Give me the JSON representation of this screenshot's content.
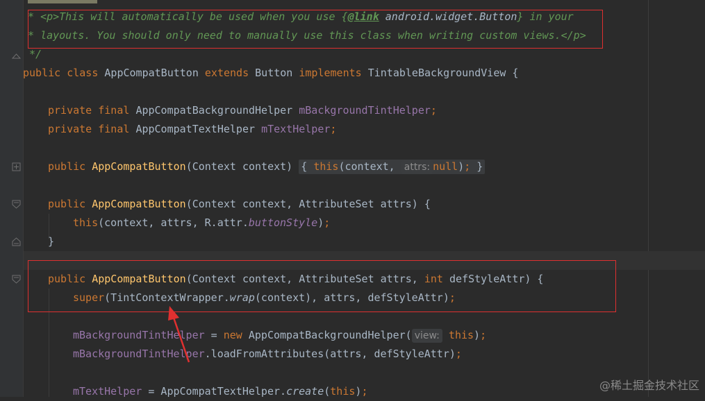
{
  "colors": {
    "background": "#2b2b2b",
    "keyword": "#cc7832",
    "method": "#ffc66d",
    "field": "#9876aa",
    "comment": "#629755",
    "text": "#a9b7c6",
    "annotation_red": "#e03030"
  },
  "icons": [
    "fold-collapsed-icon",
    "fold-open-icon",
    "fold-end-icon",
    "arrow-annotation-icon"
  ],
  "code": {
    "doc1": {
      "star": "* ",
      "open_p": "<p>",
      "text1": "This will automatically be used when you use ",
      "brace_open": "{",
      "link_tag": "@link",
      "link_target": " android.widget.Button",
      "brace_close": "}",
      "text2": " in your"
    },
    "doc2": {
      "star": "* ",
      "text": "layouts. You should only need to manually use this class when writing custom views.",
      "close_p": "</p>"
    },
    "doc_end": " */",
    "class_decl": {
      "public": "public ",
      "class": "class ",
      "name": "AppCompatButton ",
      "extends": "extends ",
      "parent": "Button ",
      "implements": "implements ",
      "iface": "TintableBackgroundView {"
    },
    "field1": {
      "mods": "private final ",
      "type": "AppCompatBackgroundHelper ",
      "name": "mBackgroundTintHelper",
      "semi": ";"
    },
    "field2": {
      "mods": "private final ",
      "type": "AppCompatTextHelper ",
      "name": "mTextHelper",
      "semi": ";"
    },
    "ctor1": {
      "public": "public ",
      "name": "AppCompatButton",
      "params": "(Context context) ",
      "brace_open": "{ ",
      "this": "this",
      "args": "(context, ",
      "hint": "attrs:",
      "null": "null",
      "rparen": ")",
      "semi": "; ",
      "brace_close": "}"
    },
    "ctor2": {
      "public": "public ",
      "name": "AppCompatButton",
      "params": "(Context context, AttributeSet attrs) {",
      "this": "this",
      "args": "(context, attrs, R.attr.",
      "style": "buttonStyle",
      "rparen": ")",
      "semi": ";",
      "close": "}"
    },
    "ctor3": {
      "public": "public ",
      "name": "AppCompatButton",
      "params1": "(Context context, AttributeSet attrs, ",
      "int": "int ",
      "params2": "defStyleAttr) {",
      "super": "super",
      "args1": "(TintContextWrapper.",
      "wrap": "wrap",
      "args2": "(context), attrs, defStyleAttr)",
      "semi": ";"
    },
    "stmt1": {
      "field": "mBackgroundTintHelper",
      "eq": " = ",
      "new": "new ",
      "call": "AppCompatBackgroundHelper(",
      "hint": "view:",
      "this": "this",
      "rparen": ")",
      "semi": ";"
    },
    "stmt2": {
      "field": "mBackgroundTintHelper",
      "call": ".loadFromAttributes(attrs, defStyleAttr)",
      "semi": ";"
    },
    "stmt3": {
      "field": "mTextHelper",
      "eq": " = AppCompatTextHelper.",
      "create": "create",
      "lparen": "(",
      "this": "this",
      "rparen": ")",
      "semi": ";"
    }
  },
  "watermark": "@稀土掘金技术社区"
}
